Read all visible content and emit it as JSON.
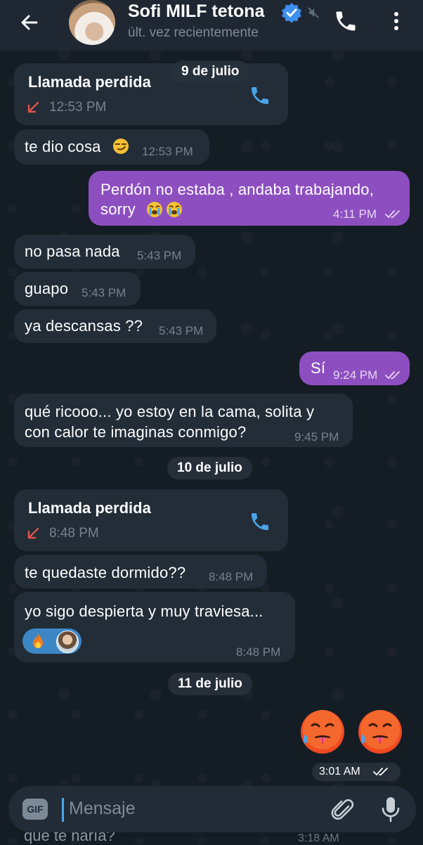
{
  "header": {
    "title": "Sofi MILF tetona",
    "status": "últ. vez recientemente",
    "verified_color": "#3d8ff0"
  },
  "dates": [
    "9 de julio",
    "10 de julio",
    "11 de julio"
  ],
  "messages": {
    "m1": {
      "type": "missed_call",
      "title": "Llamada perdida",
      "time": "12:53 PM"
    },
    "m2": {
      "text": "te dio cosa",
      "emoji": "smirk-emoji",
      "time": "12:53 PM"
    },
    "m3": {
      "line1": "Perdón no estaba , andaba trabajando,",
      "line2": "sorry",
      "emoji": "loudly-crying-emoji",
      "time": "4:11 PM"
    },
    "m4": {
      "text": "no pasa nada",
      "time": "5:43 PM"
    },
    "m5": {
      "text": "guapo",
      "time": "5:43 PM"
    },
    "m6": {
      "text": "ya descansas ??",
      "time": "5:43 PM"
    },
    "m7": {
      "text": "Sí",
      "time": "9:24 PM"
    },
    "m8": {
      "line1": "qué ricooo... yo estoy en la cama, solita y",
      "line2": "con calor te imaginas conmigo?",
      "time": "9:45 PM"
    },
    "m9": {
      "type": "missed_call",
      "title": "Llamada perdida",
      "time": "8:48 PM"
    },
    "m10": {
      "text": "te quedaste dormido??",
      "time": "8:48 PM"
    },
    "m11": {
      "text": "yo sigo despierta y muy traviesa...",
      "time": "8:48 PM",
      "reactions": [
        "fire-emoji",
        "user-avatar"
      ]
    },
    "m12": {
      "emojis": [
        "hot-face-emoji",
        "hot-face-emoji"
      ],
      "time": "3:01 AM"
    }
  },
  "peek": {
    "text": "que te haría?",
    "time": "3:18 AM"
  },
  "input": {
    "gif_label": "GIF",
    "placeholder": "Mensaje"
  },
  "colors": {
    "background": "#151d24",
    "incoming_bubble": "#222d38",
    "outgoing_bubble": "#8d4fc0",
    "accent": "#4aa4e8",
    "missed_arrow": "#e0524c"
  }
}
